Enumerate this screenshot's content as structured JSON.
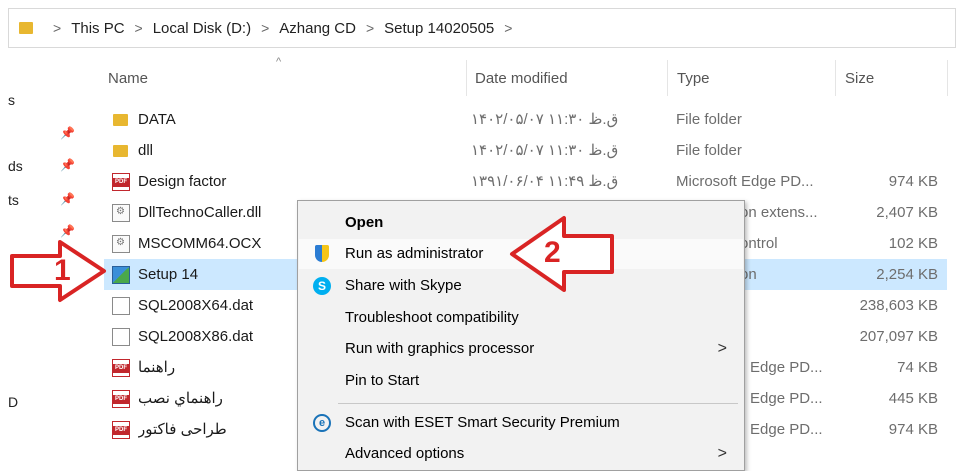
{
  "address_bar": {
    "crumbs": [
      "This PC",
      "Local Disk (D:)",
      "Azhang CD",
      "Setup 14020505"
    ]
  },
  "nav_pane": {
    "fragments": [
      "s",
      "ds",
      "ts",
      "D"
    ]
  },
  "columns": {
    "name": "Name",
    "date": "Date modified",
    "type": "Type",
    "size": "Size"
  },
  "files": [
    {
      "icon": "folder-icon",
      "name": "DATA",
      "date": "۱۴۰۲/۰۵/۰۷ ق.ظ ۱۱:۳۰",
      "type": "File folder",
      "size": ""
    },
    {
      "icon": "folder-icon",
      "name": "dll",
      "date": "۱۴۰۲/۰۵/۰۷ ق.ظ ۱۱:۳۰",
      "type": "File folder",
      "size": ""
    },
    {
      "icon": "pdf-icon",
      "name": "Design factor",
      "date": "۱۳۹۱/۰۶/۰۴ ق.ظ ۱۱:۴۹",
      "type": "Microsoft Edge PD...",
      "size": "974 KB"
    },
    {
      "icon": "dll-file-icon",
      "name": "DllTechnoCaller.dll",
      "date": "",
      "type": "on extens...",
      "size": "2,407 KB"
    },
    {
      "icon": "ocx-file-icon",
      "name": "MSCOMM64.OCX",
      "date": "",
      "type": "ontrol",
      "size": "102 KB"
    },
    {
      "icon": "setup-icon",
      "name": "Setup 14",
      "date": "",
      "type": "on",
      "size": "2,254 KB"
    },
    {
      "icon": "file-icon",
      "name": "SQL2008X64.dat",
      "date": "",
      "type": "",
      "size": "238,603 KB"
    },
    {
      "icon": "file-icon",
      "name": "SQL2008X86.dat",
      "date": "",
      "type": "",
      "size": "207,097 KB"
    },
    {
      "icon": "pdf-icon",
      "name": "راهنما",
      "date": "",
      "type": "Edge PD...",
      "size": "74 KB"
    },
    {
      "icon": "pdf-icon",
      "name": "راهنماي نصب",
      "date": "",
      "type": "Edge PD...",
      "size": "445 KB"
    },
    {
      "icon": "pdf-icon",
      "name": "طراحی فاکتور",
      "date": "",
      "type": "Edge PD...",
      "size": "974 KB"
    }
  ],
  "context_menu": {
    "items": [
      {
        "label": "Open",
        "icon": "",
        "submenu": false
      },
      {
        "label": "Run as administrator",
        "icon": "shield-icon",
        "submenu": false
      },
      {
        "label": "Share with Skype",
        "icon": "skype-icon",
        "submenu": false
      },
      {
        "label": "Troubleshoot compatibility",
        "icon": "",
        "submenu": false
      },
      {
        "label": "Run with graphics processor",
        "icon": "",
        "submenu": true
      },
      {
        "label": "Pin to Start",
        "icon": "",
        "submenu": false
      },
      {
        "label": "Scan with ESET Smart Security Premium",
        "icon": "eset-icon",
        "submenu": false
      },
      {
        "label": "Advanced options",
        "icon": "",
        "submenu": true
      }
    ],
    "submenu_glyph": ">",
    "skype_glyph": "S",
    "eset_glyph": "e"
  },
  "annotations": {
    "arrow1_number": "1",
    "arrow2_number": "2",
    "arrow_color": "#d92424"
  },
  "colors": {
    "selection": "#cce8ff",
    "folder": "#e8b730",
    "pdf": "#c1272d"
  }
}
